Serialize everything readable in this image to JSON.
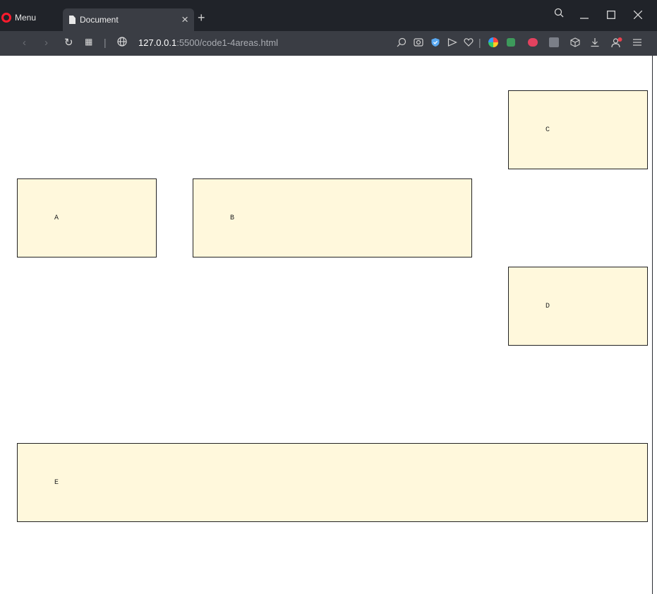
{
  "browser": {
    "menu_label": "Menu",
    "tab": {
      "title": "Document"
    },
    "address": {
      "host": "127.0.0.1",
      "path": ":5500/code1-4areas.html"
    }
  },
  "page": {
    "areas": {
      "a": "A",
      "b": "B",
      "c": "C",
      "d": "D",
      "e": "E"
    }
  },
  "colors": {
    "area_fill": "#fff8dc",
    "area_border": "#222222",
    "tab_strip": "#202329",
    "toolbar": "#3a3d44"
  }
}
